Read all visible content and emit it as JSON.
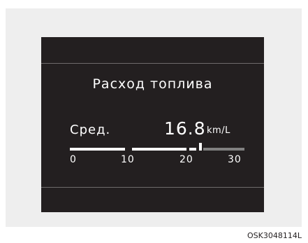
{
  "display": {
    "title": "Расход топлива",
    "average_label": "Сред.",
    "fuel_economy_value": "16.8",
    "fuel_economy_unit": "km/L",
    "gauge_value_km_per_l": 16.8,
    "gauge_min": 0,
    "gauge_max": 30,
    "scale_ticks": [
      "0",
      "10",
      "20",
      "30"
    ],
    "colors": {
      "screen_background": "#231f20",
      "text": "#ffffff",
      "bar_filled": "#ffffff",
      "bar_unfilled": "#808080"
    }
  },
  "figure_code": "OSK3048114L"
}
